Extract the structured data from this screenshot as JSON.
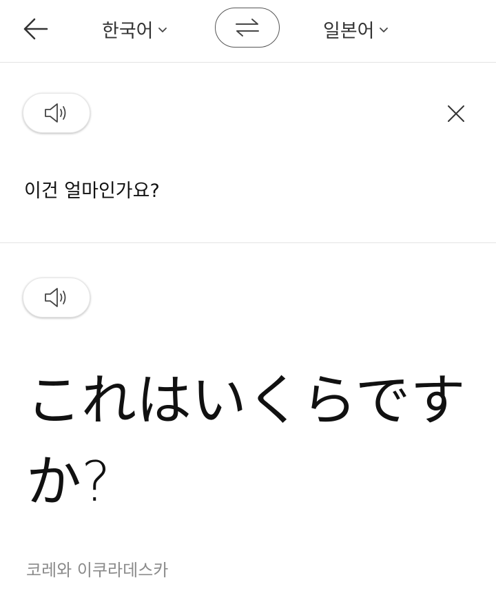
{
  "header": {
    "back_icon": "arrow-left-icon",
    "source_language": "한국어",
    "target_language": "일본어",
    "swap_icon": "swap-arrows-icon",
    "dropdown_icon": "chevron-down-icon"
  },
  "source": {
    "speak_icon": "speaker-icon",
    "clear_icon": "close-icon",
    "text": "이건 얼마인가요?"
  },
  "result": {
    "speak_icon": "speaker-icon",
    "text": "これはいくらですか?",
    "pronunciation": "코레와 이쿠라데스카"
  }
}
